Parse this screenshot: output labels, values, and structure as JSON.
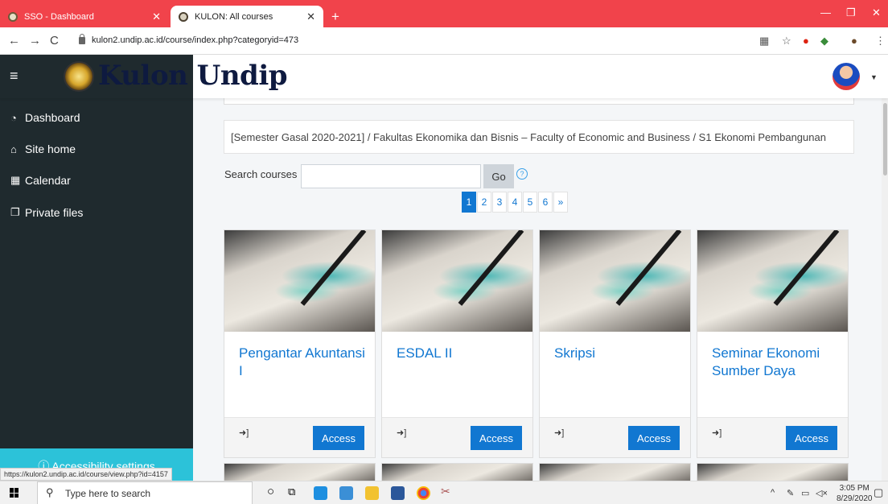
{
  "browser": {
    "tabs": [
      {
        "label": "SSO - Dashboard",
        "active": false
      },
      {
        "label": "KULON: All courses",
        "active": true
      }
    ],
    "new_tab": "+",
    "address": "kulon2.undip.ac.id/course/index.php?categoryid=473",
    "status_url": "https://kulon2.undip.ac.id/course/view.php?id=4157"
  },
  "header": {
    "brand": "Kulon Undip",
    "menu_icon": "hamburger-icon"
  },
  "sidebar": {
    "items": [
      {
        "label": "Dashboard",
        "icon": "dashboard-icon"
      },
      {
        "label": "Site home",
        "icon": "home-icon"
      },
      {
        "label": "Calendar",
        "icon": "calendar-icon"
      },
      {
        "label": "Private files",
        "icon": "files-icon"
      }
    ],
    "accessibility": "Accessibility settings"
  },
  "main": {
    "breadcrumb": "[Semester Gasal 2020-2021] / Fakultas Ekonomika dan Bisnis – Faculty of Economic and Business / S1 Ekonomi Pembangunan",
    "search": {
      "label": "Search courses",
      "value": "",
      "button": "Go"
    },
    "pagination": [
      "1",
      "2",
      "3",
      "4",
      "5",
      "6",
      "»"
    ],
    "active_page": "1",
    "courses": [
      {
        "title": "Pengantar Akuntansi I",
        "button": "Access"
      },
      {
        "title": "ESDAL II",
        "button": "Access"
      },
      {
        "title": "Skripsi",
        "button": "Access"
      },
      {
        "title": "Seminar Ekonomi Sumber Daya",
        "button": "Access"
      }
    ]
  },
  "taskbar": {
    "search_placeholder": "Type here to search",
    "time": "3:05 PM",
    "date": "8/29/2020"
  },
  "colors": {
    "accent": "#1177d1",
    "sidebar_bg": "#1f2a2e",
    "tabbar_bg": "#f1434b",
    "accessibility_bg": "#2cc2d9"
  }
}
